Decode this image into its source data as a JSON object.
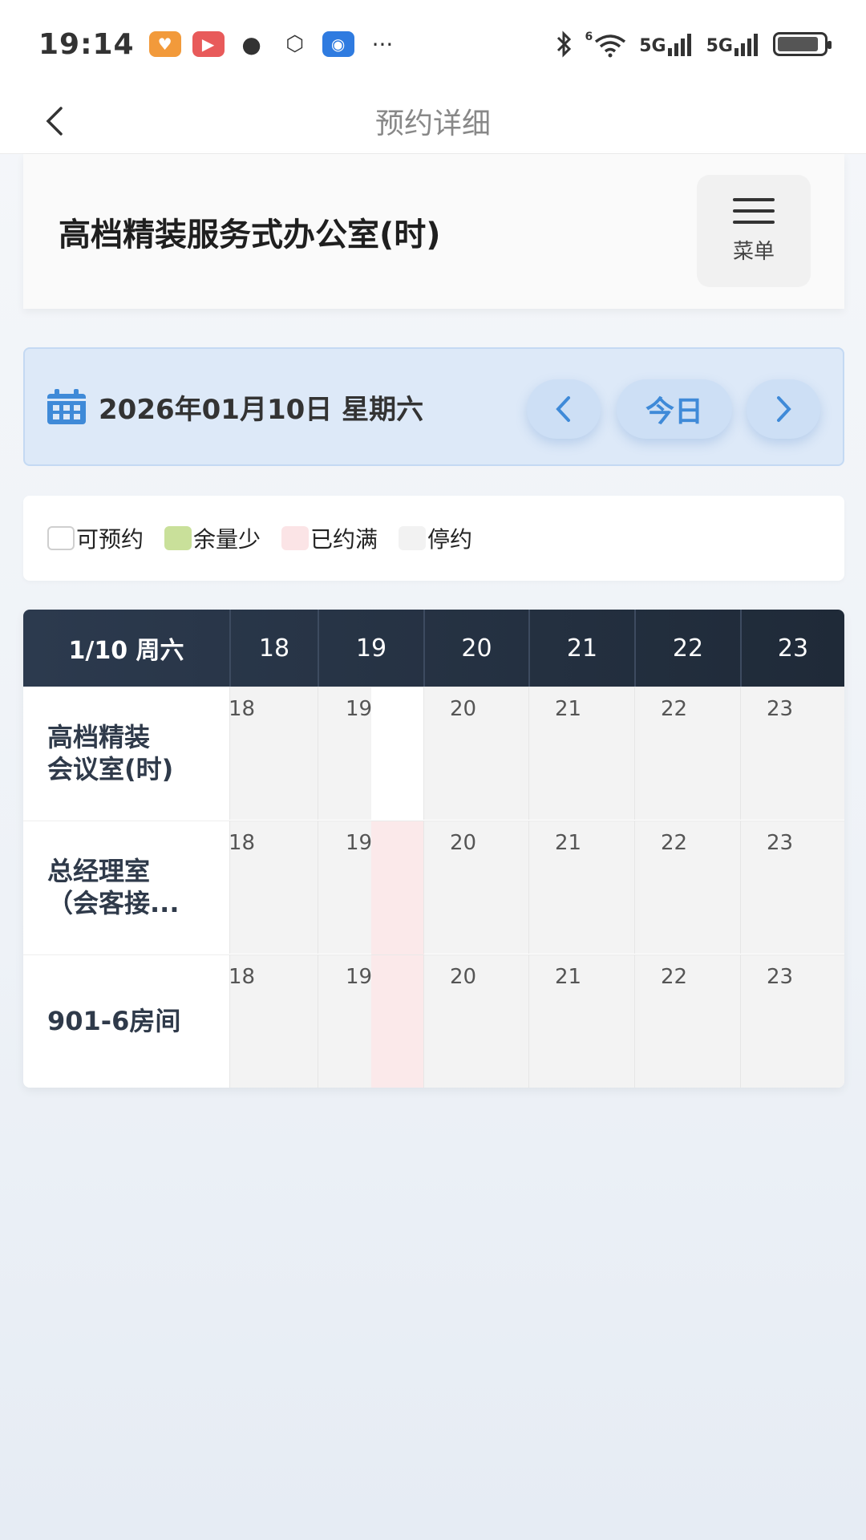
{
  "status_bar": {
    "time": "19:14",
    "dots": "···",
    "signal_1": "5G",
    "signal_2": "5G",
    "wifi_badge": "6",
    "battery_level": 0.9
  },
  "nav": {
    "title": "预约详细"
  },
  "header": {
    "room_title": "高档精装服务式办公室(时)",
    "menu_label": "菜单"
  },
  "date_bar": {
    "date_text": "2026年01月10日 星期六",
    "today_label": "今日"
  },
  "legend": [
    {
      "label": "可预约",
      "color": "#ffffff"
    },
    {
      "label": "余量少",
      "color": "#c9e09a"
    },
    {
      "label": "已约满",
      "color": "#fbe4e6"
    },
    {
      "label": "停约",
      "color": "#f2f2f2"
    }
  ],
  "schedule": {
    "date_header": "1/10 周六",
    "hours": [
      "18",
      "19",
      "20",
      "21",
      "22",
      "23"
    ],
    "rows": [
      {
        "line1": "高档精装",
        "line2": "会议室(时)"
      },
      {
        "line1": "总经理室",
        "line2": "（会客接..."
      },
      {
        "line1": "901-6房间",
        "line2": ""
      }
    ]
  },
  "colors": {
    "accent": "#3f8ad8",
    "header_dark": "#243142",
    "booked": "#fbe9ea",
    "stopped": "#f3f3f3"
  }
}
